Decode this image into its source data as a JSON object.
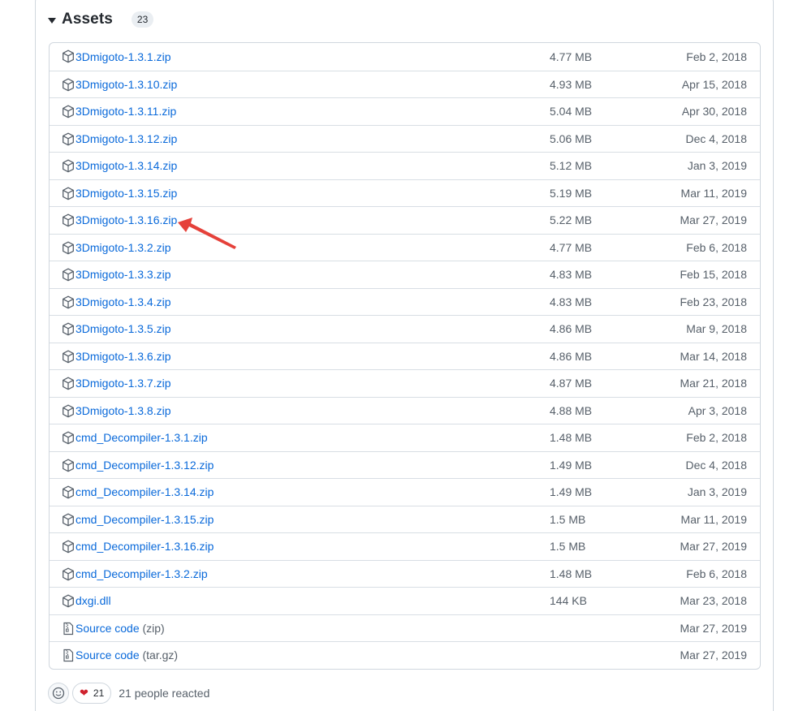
{
  "assets": {
    "title": "Assets",
    "count": "23",
    "rows": [
      {
        "name": "3Dmigoto-1.3.1.zip",
        "suffix": "",
        "size": "4.77 MB",
        "date": "Feb 2, 2018",
        "icon": "package-icon"
      },
      {
        "name": "3Dmigoto-1.3.10.zip",
        "suffix": "",
        "size": "4.93 MB",
        "date": "Apr 15, 2018",
        "icon": "package-icon"
      },
      {
        "name": "3Dmigoto-1.3.11.zip",
        "suffix": "",
        "size": "5.04 MB",
        "date": "Apr 30, 2018",
        "icon": "package-icon"
      },
      {
        "name": "3Dmigoto-1.3.12.zip",
        "suffix": "",
        "size": "5.06 MB",
        "date": "Dec 4, 2018",
        "icon": "package-icon"
      },
      {
        "name": "3Dmigoto-1.3.14.zip",
        "suffix": "",
        "size": "5.12 MB",
        "date": "Jan 3, 2019",
        "icon": "package-icon"
      },
      {
        "name": "3Dmigoto-1.3.15.zip",
        "suffix": "",
        "size": "5.19 MB",
        "date": "Mar 11, 2019",
        "icon": "package-icon"
      },
      {
        "name": "3Dmigoto-1.3.16.zip",
        "suffix": "",
        "size": "5.22 MB",
        "date": "Mar 27, 2019",
        "icon": "package-icon"
      },
      {
        "name": "3Dmigoto-1.3.2.zip",
        "suffix": "",
        "size": "4.77 MB",
        "date": "Feb 6, 2018",
        "icon": "package-icon"
      },
      {
        "name": "3Dmigoto-1.3.3.zip",
        "suffix": "",
        "size": "4.83 MB",
        "date": "Feb 15, 2018",
        "icon": "package-icon"
      },
      {
        "name": "3Dmigoto-1.3.4.zip",
        "suffix": "",
        "size": "4.83 MB",
        "date": "Feb 23, 2018",
        "icon": "package-icon"
      },
      {
        "name": "3Dmigoto-1.3.5.zip",
        "suffix": "",
        "size": "4.86 MB",
        "date": "Mar 9, 2018",
        "icon": "package-icon"
      },
      {
        "name": "3Dmigoto-1.3.6.zip",
        "suffix": "",
        "size": "4.86 MB",
        "date": "Mar 14, 2018",
        "icon": "package-icon"
      },
      {
        "name": "3Dmigoto-1.3.7.zip",
        "suffix": "",
        "size": "4.87 MB",
        "date": "Mar 21, 2018",
        "icon": "package-icon"
      },
      {
        "name": "3Dmigoto-1.3.8.zip",
        "suffix": "",
        "size": "4.88 MB",
        "date": "Apr 3, 2018",
        "icon": "package-icon"
      },
      {
        "name": "cmd_Decompiler-1.3.1.zip",
        "suffix": "",
        "size": "1.48 MB",
        "date": "Feb 2, 2018",
        "icon": "package-icon"
      },
      {
        "name": "cmd_Decompiler-1.3.12.zip",
        "suffix": "",
        "size": "1.49 MB",
        "date": "Dec 4, 2018",
        "icon": "package-icon"
      },
      {
        "name": "cmd_Decompiler-1.3.14.zip",
        "suffix": "",
        "size": "1.49 MB",
        "date": "Jan 3, 2019",
        "icon": "package-icon"
      },
      {
        "name": "cmd_Decompiler-1.3.15.zip",
        "suffix": "",
        "size": "1.5 MB",
        "date": "Mar 11, 2019",
        "icon": "package-icon"
      },
      {
        "name": "cmd_Decompiler-1.3.16.zip",
        "suffix": "",
        "size": "1.5 MB",
        "date": "Mar 27, 2019",
        "icon": "package-icon"
      },
      {
        "name": "cmd_Decompiler-1.3.2.zip",
        "suffix": "",
        "size": "1.48 MB",
        "date": "Feb 6, 2018",
        "icon": "package-icon"
      },
      {
        "name": "dxgi.dll",
        "suffix": "",
        "size": "144 KB",
        "date": "Mar 23, 2018",
        "icon": "package-icon"
      },
      {
        "name": "Source code",
        "suffix": "(zip)",
        "size": "",
        "date": "Mar 27, 2019",
        "icon": "file-zip-icon"
      },
      {
        "name": "Source code",
        "suffix": "(tar.gz)",
        "size": "",
        "date": "Mar 27, 2019",
        "icon": "file-zip-icon"
      }
    ]
  },
  "reactions": {
    "heart_count": "21",
    "summary": "21 people reacted"
  },
  "colors": {
    "link": "#0969da",
    "muted": "#57606a",
    "border": "#d0d7de",
    "annotation_arrow": "#e5413a"
  }
}
